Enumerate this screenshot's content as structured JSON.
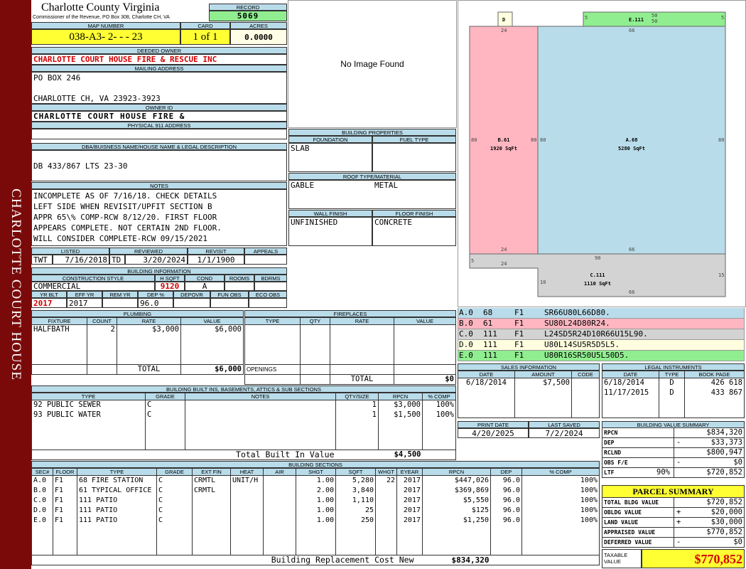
{
  "sidebar": {
    "title": "CHARLOTTE COURT HOUSE"
  },
  "county": {
    "name": "Charlotte County Virginia",
    "address": "Commissioner of the Revenue, PO Box 308, Charlotte CH, VA"
  },
  "record": {
    "label": "RECORD",
    "value": "5069"
  },
  "map": {
    "label": "MAP NUMBER",
    "value": "038-A3- 2-  -  - 23"
  },
  "card": {
    "label": "CARD",
    "value": "1 of 1"
  },
  "acres": {
    "label": "ACRES",
    "value": "0.0000"
  },
  "deeded_owner": {
    "label": "DEEDED OWNER",
    "value": "CHARLOTTE COURT HOUSE FIRE & RESCUE INC"
  },
  "mailing": {
    "label": "MAILING ADDRESS",
    "line1": "PO BOX 246",
    "line2": "CHARLOTTE CH, VA 23923-3923"
  },
  "owner_id": {
    "label": "OWNER ID",
    "value": "CHARLOTTE COURT HOUSE FIRE &"
  },
  "physical": {
    "label": "PHYSICAL 911 ADDRESS",
    "value": ""
  },
  "dba": {
    "label": "DBA/BUISNESS NAME/HOUSE NAME & LEGAL DESCRIPTION",
    "value": "DB 433/867 LTS 23-30"
  },
  "notes": {
    "label": "NOTES",
    "lines": [
      "INCOMPLETE AS OF 7/16/18. CHECK DETAILS",
      "LEFT SIDE WHEN REVISIT/UPFIT SECTION B",
      "APPR 65\\% COMP-RCW 8/12/20. FIRST FLOOR",
      "APPEARS COMPLETE. NOT CERTAIN 2ND FLOOR.",
      "WILL CONSIDER COMPLETE-RCW 09/15/2021"
    ]
  },
  "photo": {
    "text": "No Image Found"
  },
  "dates": {
    "labels": [
      "LISTED",
      "REVIEWED",
      "REVISIT",
      "APPEALS"
    ],
    "listed_by": "TWT",
    "listed": "7/16/2018",
    "reviewed_by": "TD",
    "reviewed": "3/20/2024",
    "revisit": "1/1/1900",
    "appeals": ""
  },
  "building_info": {
    "label": "BUILDING INFORMATION",
    "headers": [
      "CONSTRUCTION STYLE",
      "H SQFT",
      "COND",
      "ROOMS",
      "BDRMS"
    ],
    "style": "COMMERCIAL",
    "hsqft": "9120",
    "cond": "A",
    "rooms": "",
    "bdrms": "",
    "headers2": [
      "YR BLT",
      "EFF YR",
      "REM YR",
      "DEP %",
      "DEPOVR",
      "FUN OBS",
      "ECO OBS"
    ],
    "yr_blt": "2017",
    "eff_yr": "2017",
    "rem_yr": "",
    "dep": "96.0",
    "depovr": "",
    "fun_obs": "",
    "eco_obs": ""
  },
  "building_props": {
    "label": "BUILDING PROPERTIES",
    "foundation_label": "FOUNDATION",
    "fuel_label": "FUEL TYPE",
    "foundation": "SLAB",
    "fuel": "",
    "roof_label": "ROOF TYPE/MATERIAL",
    "roof_type": "GABLE",
    "roof_material": "METAL",
    "wall_label": "WALL FINISH",
    "floor_label": "FLOOR FINISH",
    "wall": "UNFINISHED",
    "floor": "CONCRETE"
  },
  "plumbing": {
    "label": "PLUMBING",
    "headers": [
      "FIXTURE",
      "COUNT",
      "RATE",
      "VALUE"
    ],
    "rows": [
      {
        "fixture": "HALFBATH",
        "count": "2",
        "rate": "$3,000",
        "value": "$6,000"
      }
    ],
    "total_label": "TOTAL",
    "total": "$6,000"
  },
  "fireplaces": {
    "label": "FIREPLACES",
    "headers": [
      "TYPE",
      "QTY",
      "RATE",
      "VALUE"
    ],
    "openings_label": "OPENINGS",
    "total_label": "TOTAL",
    "total": "$0"
  },
  "builtins": {
    "label": "BUILDING BUILT INS, BASEMENTS, ATTICS & SUB SECTIONS",
    "headers": [
      "TYPE",
      "GRADE",
      "NOTES",
      "QTY/SIZE",
      "RPCN",
      "% COMP"
    ],
    "rows": [
      {
        "type": "92 PUBLIC SEWER",
        "grade": "C",
        "notes": "",
        "qty": "1",
        "rpcn": "$3,000",
        "comp": "100%"
      },
      {
        "type": "93 PUBLIC WATER",
        "grade": "C",
        "notes": "",
        "qty": "1",
        "rpcn": "$1,500",
        "comp": "100%"
      }
    ],
    "total_label": "Total Built In Value",
    "total": "$4,500"
  },
  "sections": {
    "label": "BUILDING SECTIONS",
    "headers": [
      "SEC#",
      "FLOOR",
      "TYPE",
      "GRADE",
      "EXT FIN",
      "HEAT",
      "AIR",
      "SHGT",
      "SQFT",
      "WHGT",
      "EYEAR",
      "RPCN",
      "DEP",
      "% COMP"
    ],
    "rows": [
      {
        "sec": "A.0",
        "floor": "F1",
        "type": "68 FIRE STATION",
        "grade": "C",
        "ext": "CRMTL",
        "heat": "UNIT/H",
        "air": "",
        "shgt": "1.00",
        "sqft": "5,280",
        "whgt": "22",
        "eyear": "2017",
        "rpcn": "$447,026",
        "dep": "96.0",
        "comp": "100%"
      },
      {
        "sec": "B.0",
        "floor": "F1",
        "type": "61 TYPICAL OFFICE",
        "grade": "C",
        "ext": "CRMTL",
        "heat": "",
        "air": "",
        "shgt": "2.00",
        "sqft": "3,840",
        "whgt": "",
        "eyear": "2017",
        "rpcn": "$369,869",
        "dep": "96.0",
        "comp": "100%"
      },
      {
        "sec": "C.0",
        "floor": "F1",
        "type": "111 PATIO",
        "grade": "C",
        "ext": "",
        "heat": "",
        "air": "",
        "shgt": "1.00",
        "sqft": "1,110",
        "whgt": "",
        "eyear": "2017",
        "rpcn": "$5,550",
        "dep": "96.0",
        "comp": "100%"
      },
      {
        "sec": "D.0",
        "floor": "F1",
        "type": "111 PATIO",
        "grade": "C",
        "ext": "",
        "heat": "",
        "air": "",
        "shgt": "1.00",
        "sqft": "25",
        "whgt": "",
        "eyear": "2017",
        "rpcn": "$125",
        "dep": "96.0",
        "comp": "100%"
      },
      {
        "sec": "E.0",
        "floor": "F1",
        "type": "111 PATIO",
        "grade": "C",
        "ext": "",
        "heat": "",
        "air": "",
        "shgt": "1.00",
        "sqft": "250",
        "whgt": "",
        "eyear": "2017",
        "rpcn": "$1,250",
        "dep": "96.0",
        "comp": "100%"
      }
    ],
    "total_label": "Building Replacement Cost New",
    "total": "$834,320"
  },
  "sketch": {
    "labels": {
      "d_label": "D",
      "e_label": "E.111",
      "b_label": "B.61",
      "b_area": "1920 SqFt",
      "a_label": "A.68",
      "a_area": "5280 SqFt",
      "c_label": "C.111",
      "c_area": "1110 SqFt"
    },
    "dims": [
      "24",
      "66",
      "80",
      "80",
      "80",
      "80",
      "24",
      "66",
      "90",
      "5",
      "24",
      "15",
      "10",
      "66",
      "5",
      "50",
      "50",
      "5"
    ]
  },
  "vectors": {
    "rows": [
      {
        "id": "A.0",
        "code": "68",
        "floor": "F1",
        "vec": "SR66U80L66D80.",
        "color": "#b9dcea"
      },
      {
        "id": "B.0",
        "code": "61",
        "floor": "F1",
        "vec": "SU80L24D80R24.",
        "color": "#ffb6c1"
      },
      {
        "id": "C.0",
        "code": "111",
        "floor": "F1",
        "vec": "L24SD5R24D10R66U15L90.",
        "color": "#d3d3d3"
      },
      {
        "id": "D.0",
        "code": "111",
        "floor": "F1",
        "vec": "U80L14SU5R5D5L5.",
        "color": "#ffffe0"
      },
      {
        "id": "E.0",
        "code": "111",
        "floor": "F1",
        "vec": "U80R16SR50U5L50D5.",
        "color": "#90ee90"
      }
    ]
  },
  "sales": {
    "label": "SALES INFORMATION",
    "headers": [
      "DATE",
      "AMOUNT",
      "CODE"
    ],
    "rows": [
      {
        "date": "6/18/2014",
        "amount": "$7,500",
        "code": ""
      }
    ]
  },
  "legal": {
    "label": "LEGAL INSTRUMENTS",
    "headers": [
      "DATE",
      "TYPE",
      "BOOK PAGE"
    ],
    "rows": [
      {
        "date": "6/18/2014",
        "type": "D",
        "book": "426 618"
      },
      {
        "date": "11/17/2015",
        "type": "D",
        "book": "433 867"
      }
    ]
  },
  "print": {
    "print_label": "PRINT DATE",
    "print_date": "4/20/2025",
    "saved_label": "LAST SAVED",
    "saved": "7/2/2024"
  },
  "value_summary": {
    "label": "BUILDING VALUE SUMMARY",
    "rows": [
      {
        "label": "RPCN",
        "sign": "",
        "pct": "",
        "value": "$834,320"
      },
      {
        "label": "DEP",
        "sign": "-",
        "pct": "",
        "value": "$33,373"
      },
      {
        "label": "RCLND",
        "sign": "",
        "pct": "",
        "value": "$800,947"
      },
      {
        "label": "OBS F/E",
        "sign": "-",
        "pct": "",
        "value": "$0"
      },
      {
        "label": "LTF",
        "sign": "",
        "pct": "90%",
        "value": "$720,852"
      }
    ]
  },
  "parcel": {
    "label": "PARCEL SUMMARY",
    "rows": [
      {
        "label": "TOTAL BLDG VALUE",
        "sign": "",
        "value": "$720,852"
      },
      {
        "label": "OBLDG VALUE",
        "sign": "+",
        "value": "$20,000"
      },
      {
        "label": "LAND VALUE",
        "sign": "+",
        "value": "$30,000"
      },
      {
        "label": "APPRAISED VALUE",
        "sign": "",
        "value": "$770,852"
      },
      {
        "label": "DEFERRED VALUE",
        "sign": "-",
        "value": "$0"
      }
    ],
    "taxable_label": "TAXABLE VALUE",
    "taxable": "$770,852"
  }
}
